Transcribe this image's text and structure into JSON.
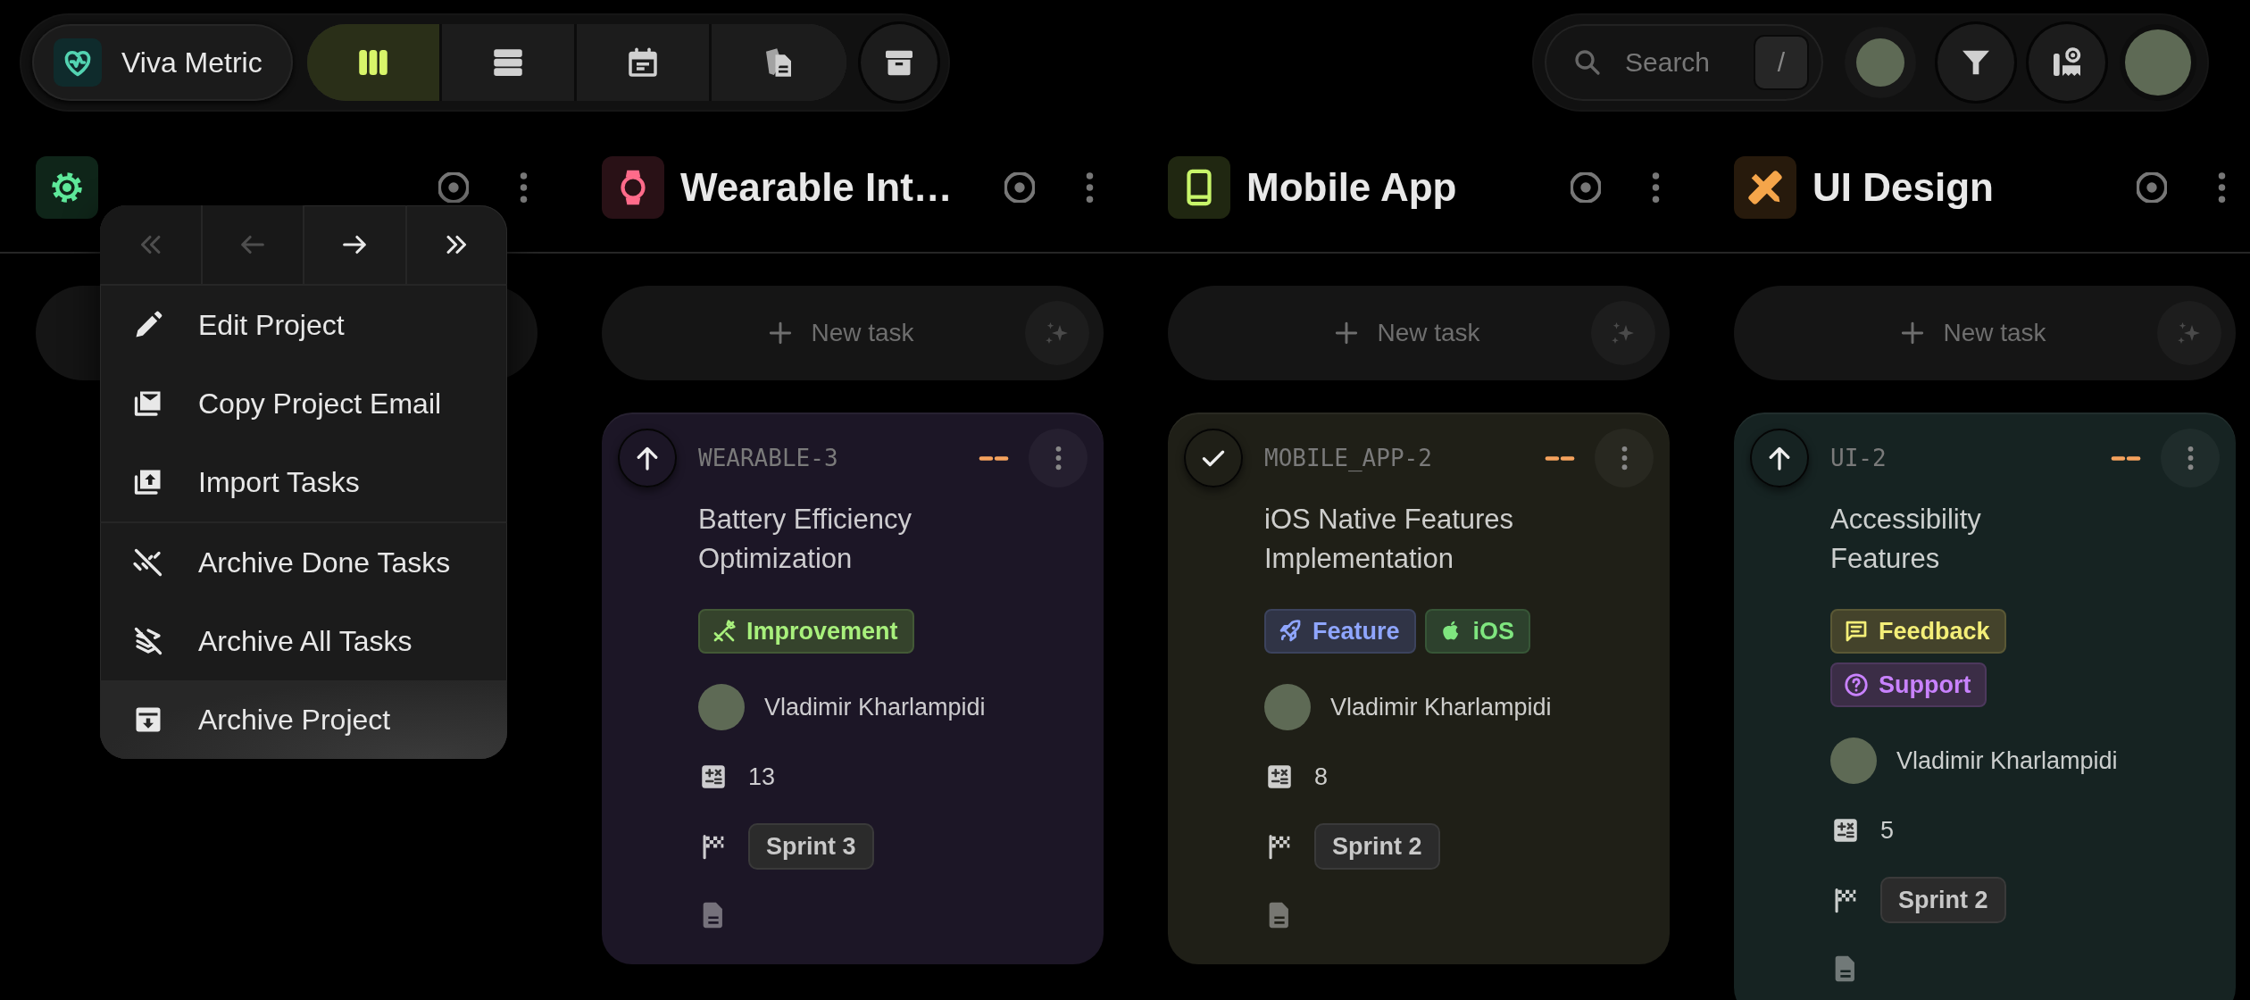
{
  "app": {
    "name": "Viva Metric"
  },
  "view_tabs": [
    {
      "kind": "board",
      "selected": true
    },
    {
      "kind": "list",
      "selected": false
    },
    {
      "kind": "calendar",
      "selected": false
    },
    {
      "kind": "docs",
      "selected": false
    }
  ],
  "search": {
    "placeholder": "Search",
    "shortcut": "/"
  },
  "columns": [
    {
      "kind": "gear",
      "color": "#5ee89a"
    },
    {
      "title": "Wearable Int…",
      "kind": "watch",
      "color": "#ff6b8a",
      "new_task_label": "New task",
      "tasks": [
        {
          "id": "WEARABLE-3",
          "done": false,
          "color": "#1c1626",
          "title": "Battery Efficiency Optimization",
          "tags": [
            {
              "label": "Improvement",
              "kind": "improvement",
              "color": "#a8f07c"
            }
          ],
          "assignee": "Vladimir Kharlampidi",
          "estimate": "13",
          "sprint": "Sprint 3"
        }
      ]
    },
    {
      "title": "Mobile App",
      "kind": "phone",
      "color": "#c8f56a",
      "new_task_label": "New task",
      "tasks": [
        {
          "id": "MOBILE_APP-2",
          "done": true,
          "color": "#1f1f17",
          "title": "iOS Native Features Implementation",
          "tags": [
            {
              "label": "Feature",
              "kind": "feature",
              "color": "#8fa6ff"
            },
            {
              "label": "iOS",
              "kind": "ios",
              "color": "#7fe57f"
            }
          ],
          "assignee": "Vladimir Kharlampidi",
          "estimate": "8",
          "sprint": "Sprint 2"
        }
      ]
    },
    {
      "title": "UI Design",
      "kind": "design",
      "color": "#f5a54a",
      "new_task_label": "New task",
      "tasks": [
        {
          "id": "UI-2",
          "done": false,
          "color": "#162322",
          "title": "Accessibility Features",
          "tags": [
            {
              "label": "Feedback",
              "kind": "feedback",
              "color": "#f3ee78"
            },
            {
              "label": "Support",
              "kind": "support",
              "color": "#c982ff"
            }
          ],
          "assignee": "Vladimir Kharlampidi",
          "estimate": "5",
          "sprint": "Sprint 2"
        }
      ]
    }
  ],
  "context_menu": {
    "nav": [
      {
        "kind": "first",
        "disabled": true
      },
      {
        "kind": "prev",
        "disabled": true
      },
      {
        "kind": "next",
        "disabled": false
      },
      {
        "kind": "last",
        "disabled": false
      }
    ],
    "groups": [
      [
        {
          "label": "Edit Project",
          "kind": "edit",
          "selected": false
        },
        {
          "label": "Copy Project Email",
          "kind": "email",
          "selected": false
        },
        {
          "label": "Import Tasks",
          "kind": "import",
          "selected": false
        }
      ],
      [
        {
          "label": "Archive Done Tasks",
          "kind": "archive_done",
          "selected": false
        },
        {
          "label": "Archive All Tasks",
          "kind": "archive_all",
          "selected": false
        },
        {
          "label": "Archive Project",
          "kind": "archive_project",
          "selected": true
        }
      ]
    ]
  }
}
